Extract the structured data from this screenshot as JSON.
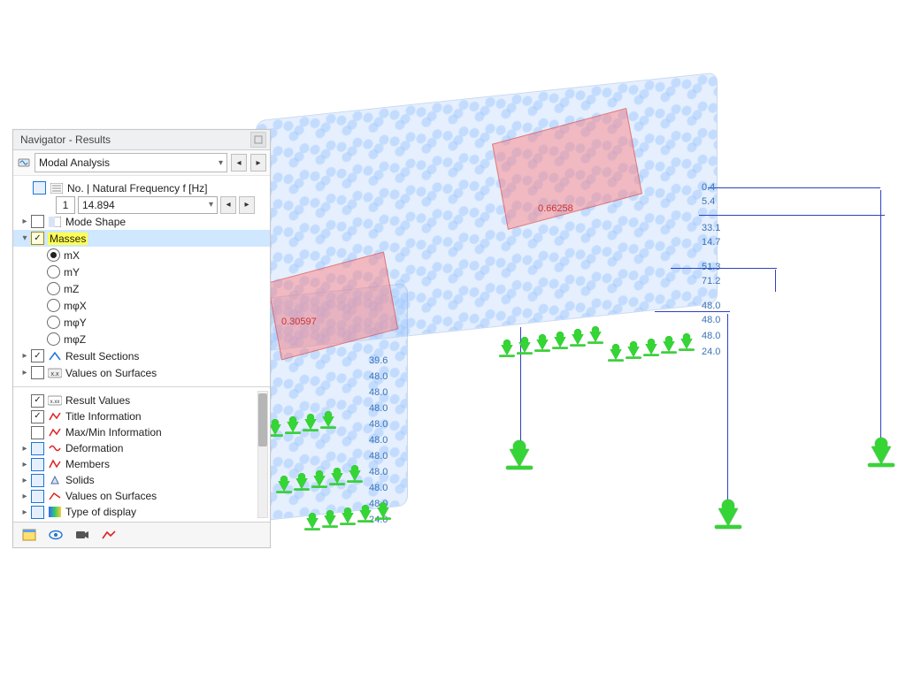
{
  "panel": {
    "title": "Navigator - Results",
    "analysis_combo": "Modal Analysis",
    "freq_header": "No. | Natural Frequency f [Hz]",
    "freq_no": "1",
    "freq_val": "14.894",
    "mode_shape": "Mode Shape",
    "masses": "Masses",
    "mass_components": {
      "mx": "mX",
      "my": "mY",
      "mz": "mZ",
      "mphx": "mφX",
      "mphy": "mφY",
      "mphz": "mφZ"
    },
    "result_sections": "Result Sections",
    "values_on_surfaces": "Values on Surfaces"
  },
  "lower": {
    "result_values": "Result Values",
    "title_information": "Title Information",
    "maxmin": "Max/Min Information",
    "deformation": "Deformation",
    "members": "Members",
    "solids": "Solids",
    "values_on_surfaces": "Values on Surfaces",
    "type_of_display": "Type of display"
  },
  "viewport": {
    "label_a": "0.66258",
    "label_b": "0.30597",
    "side_vals": [
      "0.4",
      "5.4",
      "33.1",
      "14.7",
      "51.3",
      "71.2",
      "48.0",
      "48.0",
      "48.0",
      "24.0"
    ],
    "col_vals": [
      "39.6",
      "48.0",
      "48.0",
      "48.0",
      "48.0",
      "48.0",
      "48.0",
      "48.0",
      "48.0",
      "48.0",
      "24.0"
    ]
  }
}
